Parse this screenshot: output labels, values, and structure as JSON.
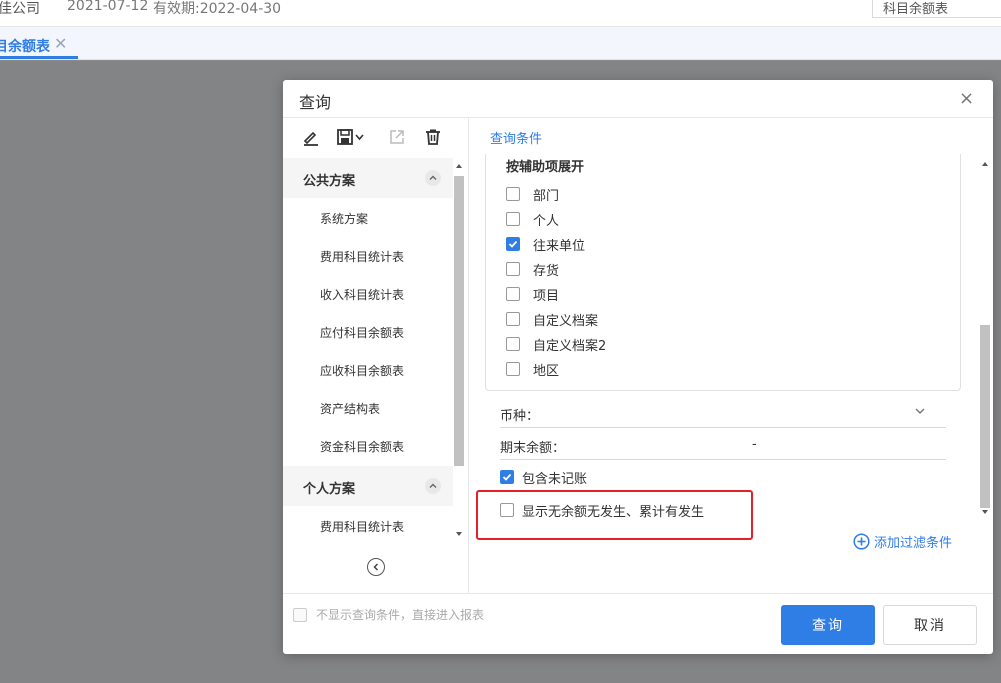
{
  "topbar": {
    "company": "佳公司",
    "date": "2021-07-12",
    "valid": "有效期:2022-04-30",
    "right_box": "科目余额表"
  },
  "tab": {
    "label": "目余额表",
    "close": "✕"
  },
  "dialog": {
    "title": "查询",
    "close": "×",
    "left": {
      "toolbar_icons": [
        "edit-icon",
        "save-icon",
        "export-icon",
        "delete-icon"
      ],
      "groups": [
        {
          "title": "公共方案",
          "items": [
            "系统方案",
            "费用科目统计表",
            "收入科目统计表",
            "应付科目余额表",
            "应收科目余额表",
            "资产结构表",
            "资金科目余额表"
          ]
        },
        {
          "title": "个人方案",
          "items": [
            "费用科目统计表"
          ]
        }
      ]
    },
    "right": {
      "title": "查询条件",
      "aux_head": "按辅助项展开",
      "aux_items": [
        {
          "label": "部门",
          "checked": false
        },
        {
          "label": "个人",
          "checked": false
        },
        {
          "label": "往来单位",
          "checked": true
        },
        {
          "label": "存货",
          "checked": false
        },
        {
          "label": "项目",
          "checked": false
        },
        {
          "label": "自定义档案",
          "checked": false
        },
        {
          "label": "自定义档案2",
          "checked": false
        },
        {
          "label": "地区",
          "checked": false
        }
      ],
      "currency_label": "币种：",
      "currency_value": "",
      "end_balance_label": "期末余额：",
      "end_balance_value": "-",
      "include_unposted": {
        "label": "包含未记账",
        "checked": true
      },
      "show_zero": {
        "label": "显示无余额无发生、累计有发生",
        "checked": false
      },
      "add_filter": "添加过滤条件"
    },
    "footer": {
      "skip_label": "不显示查询条件，直接进入报表",
      "query_button": "查询",
      "cancel_button": "取消"
    }
  },
  "colors": {
    "accent": "#2f7ee5",
    "highlight_box": "#e3202b"
  }
}
